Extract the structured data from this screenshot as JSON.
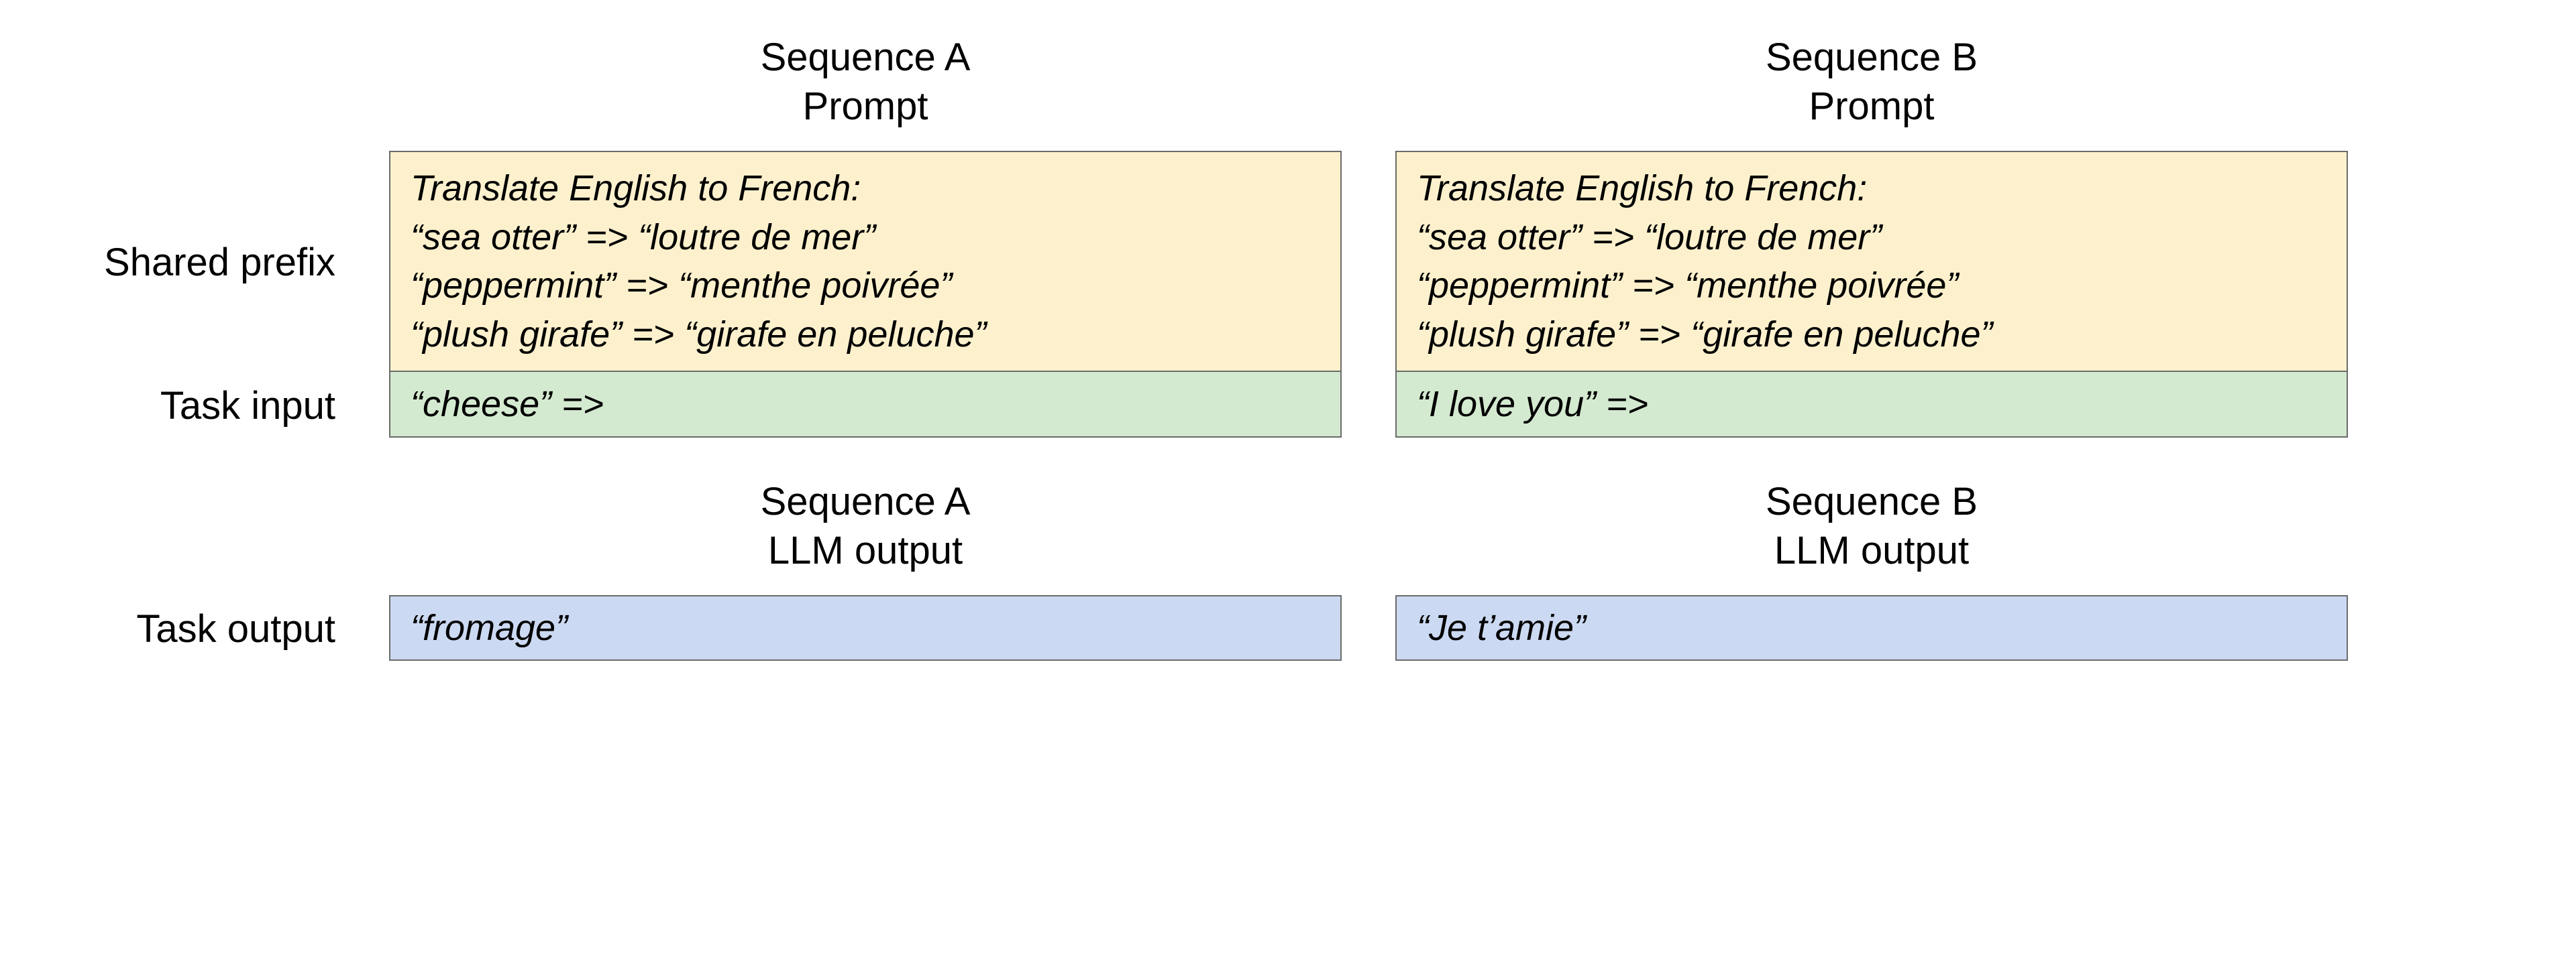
{
  "labels": {
    "shared_prefix": "Shared prefix",
    "task_input": "Task input",
    "task_output": "Task output"
  },
  "sequences": {
    "a": {
      "header_line1": "Sequence A",
      "header_line2": "Prompt",
      "prefix_line1": "Translate English to French:",
      "prefix_line2": "“sea otter” => “loutre de mer”",
      "prefix_line3": "“peppermint” => “menthe poivrée”",
      "prefix_line4": "“plush girafe” => “girafe en peluche”",
      "task_input": "“cheese” =>",
      "output_header_line1": "Sequence A",
      "output_header_line2": "LLM output",
      "task_output": "“fromage”"
    },
    "b": {
      "header_line1": "Sequence B",
      "header_line2": "Prompt",
      "prefix_line1": "Translate English to French:",
      "prefix_line2": "“sea otter” => “loutre de mer”",
      "prefix_line3": "“peppermint” => “menthe poivrée”",
      "prefix_line4": "“plush girafe” => “girafe en peluche”",
      "task_input": "“I love you” =>",
      "output_header_line1": "Sequence B",
      "output_header_line2": "LLM output",
      "task_output": "“Je t’amie”"
    }
  }
}
